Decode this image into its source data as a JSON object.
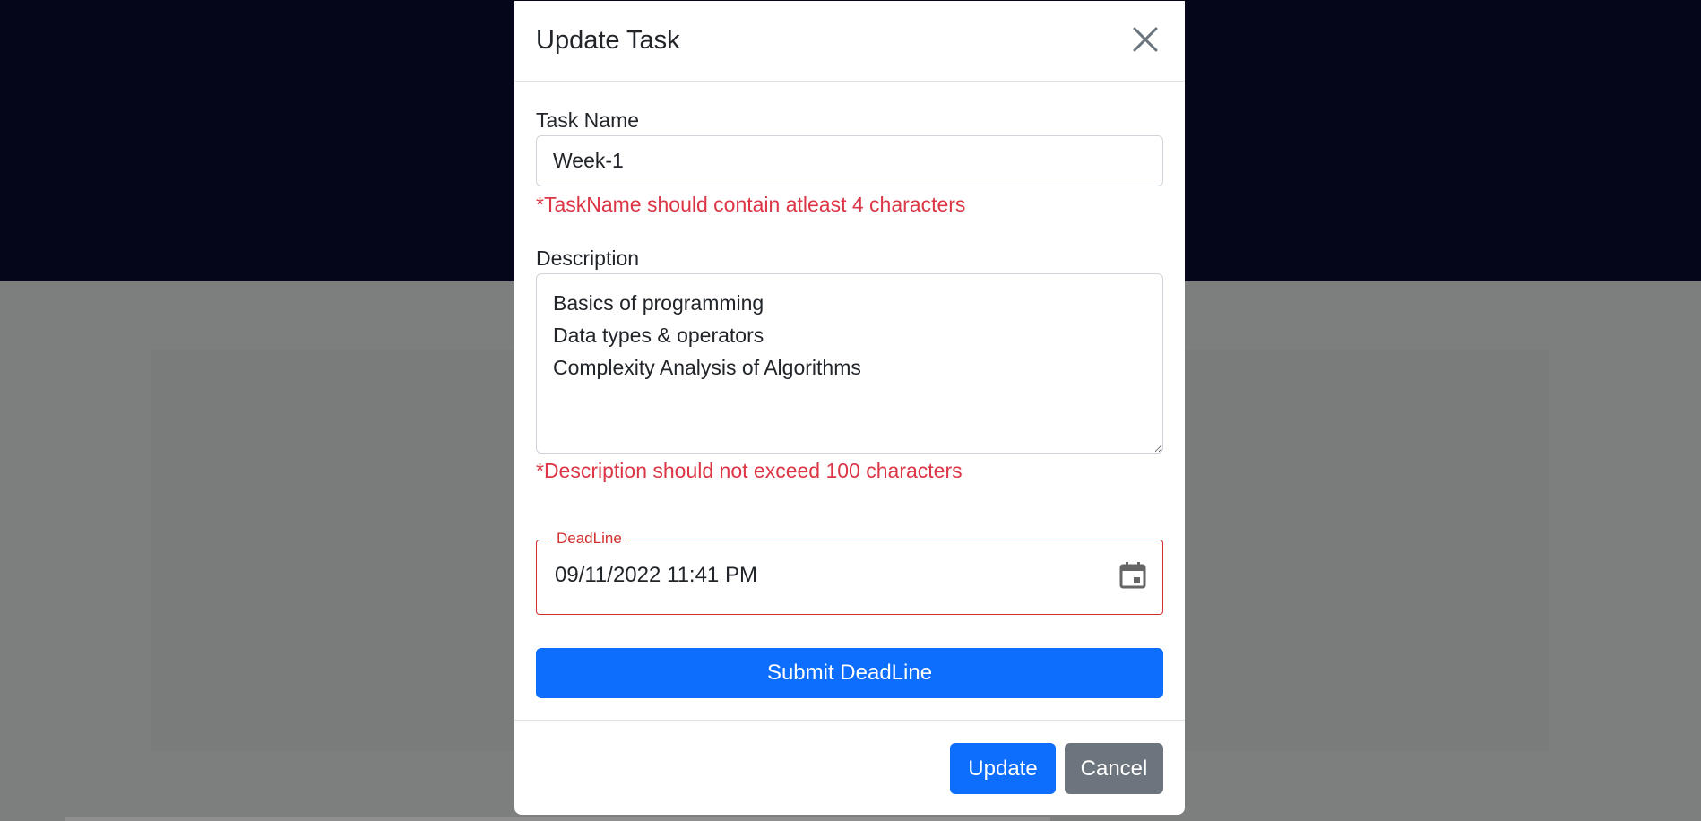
{
  "modal": {
    "title": "Update Task",
    "task_name_label": "Task Name",
    "task_name_value": "Week-1",
    "task_name_error": "*TaskName should contain atleast 4 characters",
    "description_label": "Description",
    "description_value": "Basics of programming\nData types & operators\nComplexity Analysis of Algorithms",
    "description_error": "*Description should not exceed 100 characters",
    "deadline_label": "DeadLine",
    "deadline_value": "09/11/2022 11:41 PM",
    "submit_deadline_label": "Submit DeadLine",
    "update_label": "Update",
    "cancel_label": "Cancel"
  },
  "icons": {
    "close": "close-icon",
    "calendar": "calendar-icon"
  },
  "colors": {
    "primary": "#0d6efd",
    "secondary": "#6c757d",
    "error": "#dc3545",
    "backdrop_dark": "#06061a",
    "backdrop_gray": "#7d7e7e"
  }
}
